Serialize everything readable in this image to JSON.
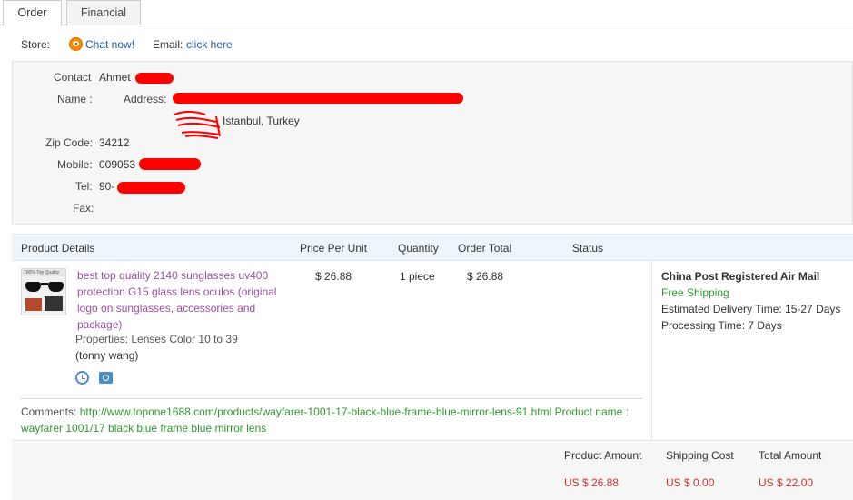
{
  "tabs": [
    {
      "label": "Order",
      "active": true
    },
    {
      "label": "Financial",
      "active": false
    }
  ],
  "store": {
    "store_label": "Store:",
    "chat_label": "Chat now!",
    "email_label": "Email:",
    "email_link": "click here",
    "chat_icon": "chat-icon"
  },
  "address": {
    "contact_name_label_1": "Contact",
    "contact_name_label_2": "Name :",
    "contact_name_value": "Ahmet",
    "address_label": "Address:",
    "address_line2": "Istanbul, Turkey",
    "zip_label": "Zip Code:",
    "zip_value": "34212",
    "mobile_label": "Mobile:",
    "mobile_value": "009053",
    "tel_label": "Tel:",
    "tel_value": "90-",
    "fax_label": "Fax:",
    "fax_value": "",
    "redaction_color": "#ff0000"
  },
  "products": {
    "headers": [
      "Product Details",
      "Price Per Unit",
      "Quantity",
      "Order Total",
      "Status"
    ],
    "item": {
      "title": "best top quality 2140 sunglasses uv400 protection G15 glass lens oculos (original logo on sunglasses, accessories and package)",
      "properties": "Properties: Lenses Color 10 to 39",
      "seller": "(tonny wang)",
      "price": "$ 26.88",
      "quantity": "1 piece",
      "order_total": "$ 26.88",
      "status": "",
      "thumb_caption": "100% Top Quality"
    },
    "comments_label": "Comments:",
    "comments_text": "http://www.topone1688.com/products/wayfarer-1001-17-black-blue-frame-blue-mirror-lens-91.html Product name : wayfarer 1001/17 black blue frame blue mirror lens",
    "shipping": {
      "method": "China Post Registered Air Mail",
      "free": "Free Shipping",
      "delivery": "Estimated Delivery Time: 15-27 Days",
      "processing": "Processing Time: 7 Days"
    }
  },
  "summary": {
    "product_amount_label": "Product Amount",
    "shipping_cost_label": "Shipping Cost",
    "total_amount_label": "Total Amount",
    "product_amount": "US $ 26.88",
    "shipping_cost": "US $ 0.00",
    "total_amount": "US $ 22.00"
  },
  "colors": {
    "link_blue": "#1d5ba8",
    "product_purple": "#9b4fa0",
    "green": "#2f9a2f",
    "price_red": "#c8342c",
    "header_bg": "#eef5fc"
  }
}
